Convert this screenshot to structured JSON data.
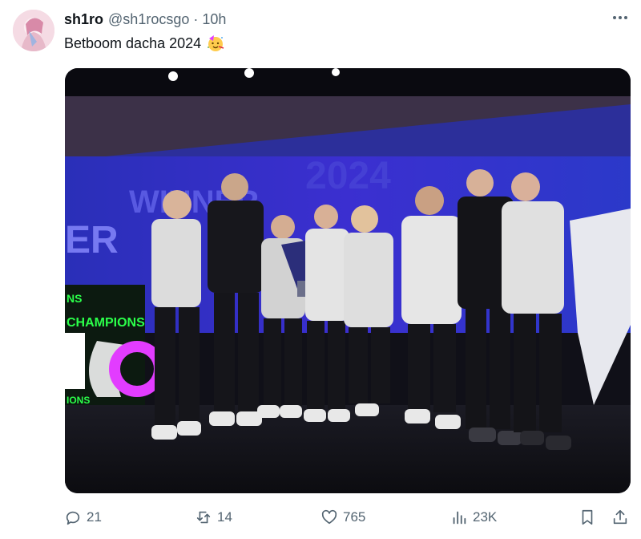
{
  "post": {
    "display_name": "sh1ro",
    "handle": "@sh1rocsgo",
    "separator": "·",
    "time": "10h",
    "text": "Betboom dacha 2024",
    "emoji": "partying-face-emoji"
  },
  "media": {
    "kind": "photo",
    "stage_texts": [
      "CHAMPIONS",
      "CHAMPIONS",
      "CHAMPIONS"
    ]
  },
  "actions": {
    "replies": "21",
    "reposts": "14",
    "likes": "765",
    "views": "23K"
  },
  "icons": {
    "more": "more-horizontal-icon",
    "reply": "reply-icon",
    "repost": "repost-icon",
    "like": "heart-icon",
    "views": "views-chart-icon",
    "bookmark": "bookmark-icon",
    "share": "share-icon"
  },
  "colors": {
    "text_primary": "#0f1419",
    "text_secondary": "#536471",
    "stage_blue": "#3b2fd0",
    "stage_green": "#2bff4a",
    "stage_magenta": "#e23cff"
  }
}
